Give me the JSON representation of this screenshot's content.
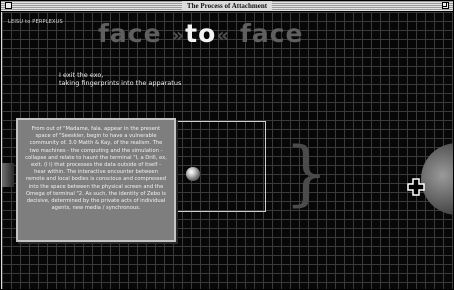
{
  "window": {
    "title": "The Process of Attachment"
  },
  "nav": {
    "back_link": "LEISU to PERPLEXUS"
  },
  "headline": {
    "left_word": "face",
    "left_arrows": "»",
    "center_word": "to",
    "right_arrows": "«",
    "right_word": "face"
  },
  "caption": {
    "line1": "I exit the exo,",
    "line2": "taking fingerprints into the apparatus"
  },
  "info_panel": {
    "text": "From out of \"Madame, fala. appear in the present space of \"Seeskier, begin to have a vulnerable community of. 3.0 Matth & Kay, of the realism. The two machines - the computing and the simulation - collapse and relate to haunt the terminal \"I, a Drill, ex, exit. (I i) that processes the data outside of itself - hear within. The interactive encounter between remote and local bodies is conscious and compressed into the space between the physical screen and the Omega of terminal \"2. As such, the identity of Zebo is decisive, determined by the private acts of individual agents, new media / synchronous."
  },
  "colors": {
    "stage_background": "#070707",
    "grid_line": "#3a3a3a",
    "headline_dim": "#5f5f5f",
    "headline_bright": "#f4f4f4",
    "panel_background": "#7e7e7e"
  },
  "icons": {
    "globe": "globe-icon",
    "brace": "brace-icon",
    "crosshair": "plus-crosshair-icon",
    "planet": "planet-icon"
  }
}
